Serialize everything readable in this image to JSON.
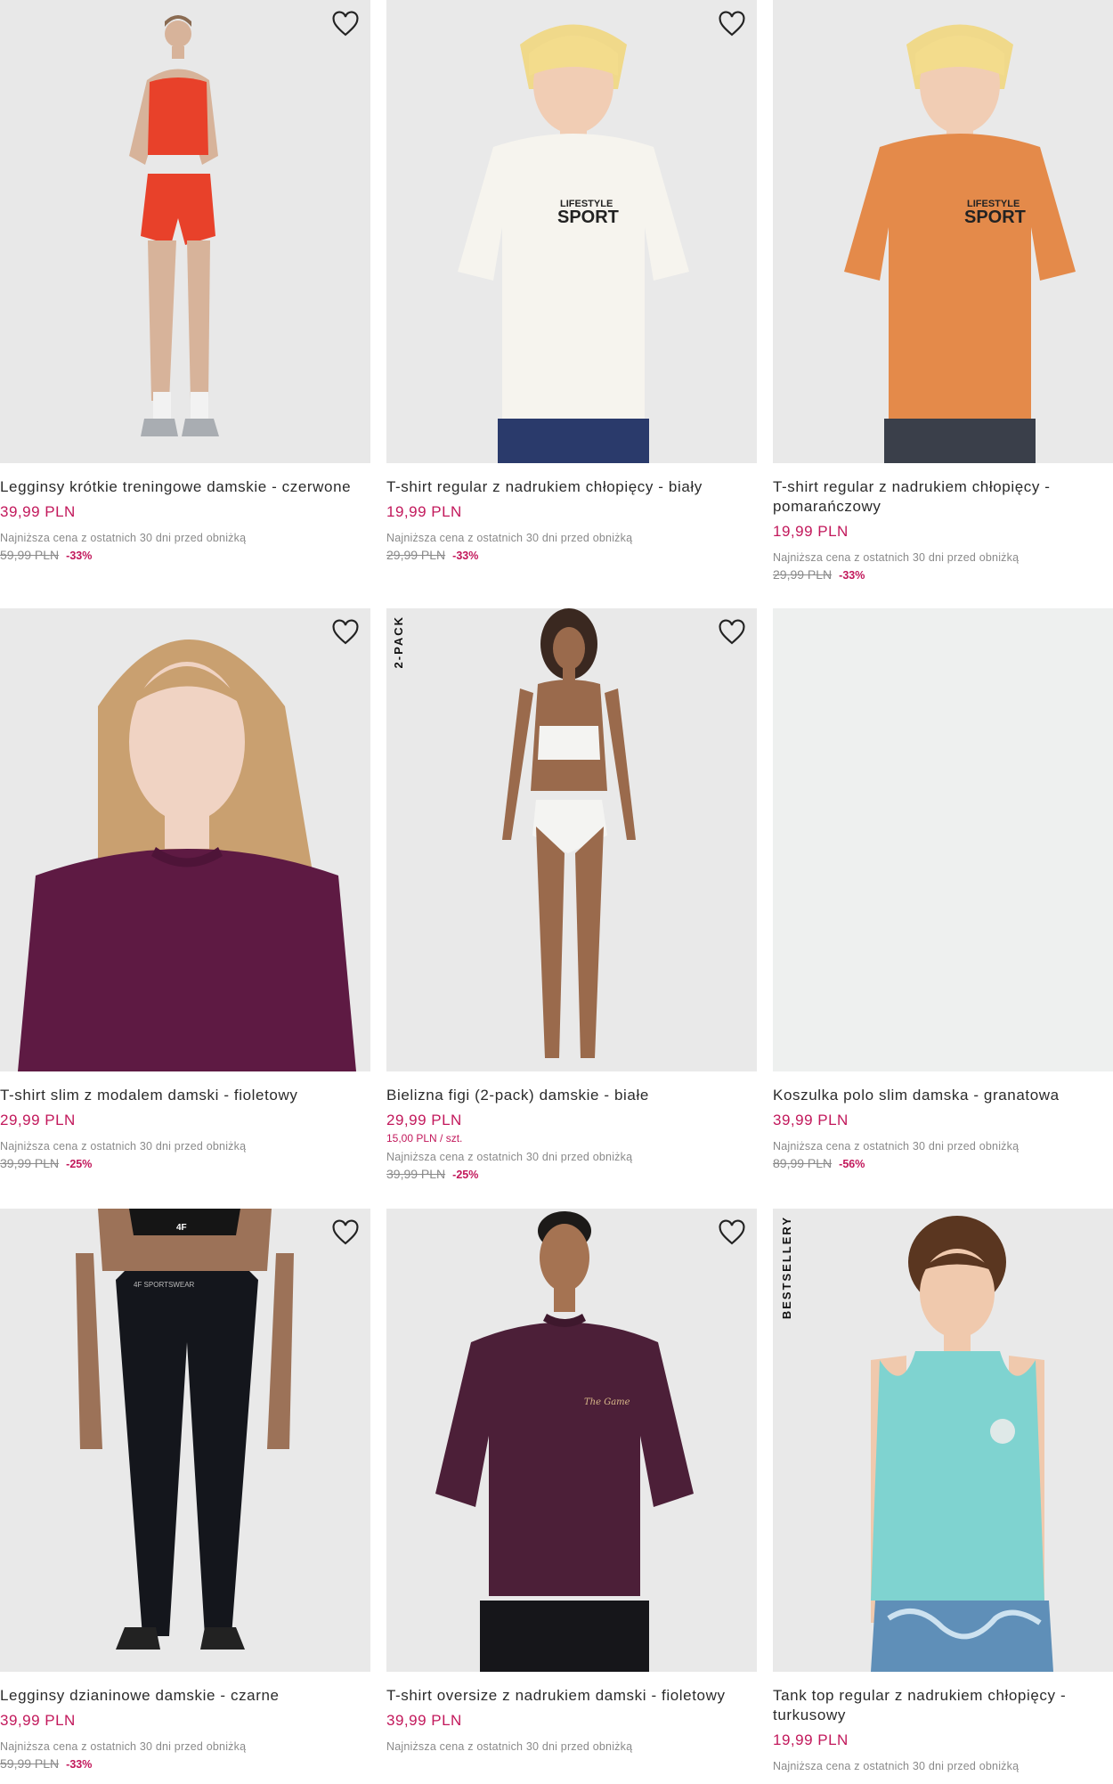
{
  "colors": {
    "accent": "#c2185b",
    "muted": "#8a8a8a",
    "image_bg": "#e9e9e9"
  },
  "icons": {
    "wishlist": "heart-icon"
  },
  "products": [
    {
      "title": "Legginsy krótkie treningowe damskie - czerwone",
      "price": "39,99 PLN",
      "unit_price": "",
      "lowest_note": "Najniższa cena z ostatnich 30 dni przed obniżką",
      "old_price": "59,99 PLN",
      "discount": "-33%",
      "badge": ""
    },
    {
      "title": "T-shirt regular z nadrukiem chłopięcy - biały",
      "price": "19,99 PLN",
      "unit_price": "",
      "lowest_note": "Najniższa cena z ostatnich 30 dni przed obniżką",
      "old_price": "29,99 PLN",
      "discount": "-33%",
      "badge": ""
    },
    {
      "title": "T-shirt regular z nadrukiem chłopięcy - pomarańczowy",
      "price": "19,99 PLN",
      "unit_price": "",
      "lowest_note": "Najniższa cena z ostatnich 30 dni przed obniżką",
      "old_price": "29,99 PLN",
      "discount": "-33%",
      "badge": ""
    },
    {
      "title": "T-shirt slim z modalem damski - fioletowy",
      "price": "29,99 PLN",
      "unit_price": "",
      "lowest_note": "Najniższa cena z ostatnich 30 dni przed obniżką",
      "old_price": "39,99 PLN",
      "discount": "-25%",
      "badge": ""
    },
    {
      "title": "Bielizna figi (2-pack) damskie - białe",
      "price": "29,99 PLN",
      "unit_price": "15,00 PLN / szt.",
      "lowest_note": "Najniższa cena z ostatnich 30 dni przed obniżką",
      "old_price": "39,99 PLN",
      "discount": "-25%",
      "badge": "2-PACK"
    },
    {
      "title": "Koszulka polo slim damska - granatowa",
      "price": "39,99 PLN",
      "unit_price": "",
      "lowest_note": "Najniższa cena z ostatnich 30 dni przed obniżką",
      "old_price": "89,99 PLN",
      "discount": "-56%",
      "badge": ""
    },
    {
      "title": "Legginsy dzianinowe damskie - czarne",
      "price": "39,99 PLN",
      "unit_price": "",
      "lowest_note": "Najniższa cena z ostatnich 30 dni przed obniżką",
      "old_price": "59,99 PLN",
      "discount": "-33%",
      "badge": ""
    },
    {
      "title": "T-shirt oversize z nadrukiem damski - fioletowy",
      "price": "39,99 PLN",
      "unit_price": "",
      "lowest_note": "Najniższa cena z ostatnich 30 dni przed obniżką",
      "old_price": "",
      "discount": "",
      "badge": ""
    },
    {
      "title": "Tank top regular z nadrukiem chłopięcy - turkusowy",
      "price": "19,99 PLN",
      "unit_price": "",
      "lowest_note": "Najniższa cena z ostatnich 30 dni przed obniżką",
      "old_price": "",
      "discount": "",
      "badge": "BESTSELLERY"
    }
  ],
  "artwork": {
    "print_lifestyle": "LIFESTYLE",
    "print_sport": "SPORT",
    "print_game": "The Game",
    "leggings_waistband": "4F SPORTSWEAR",
    "bra_logo": "4F"
  }
}
